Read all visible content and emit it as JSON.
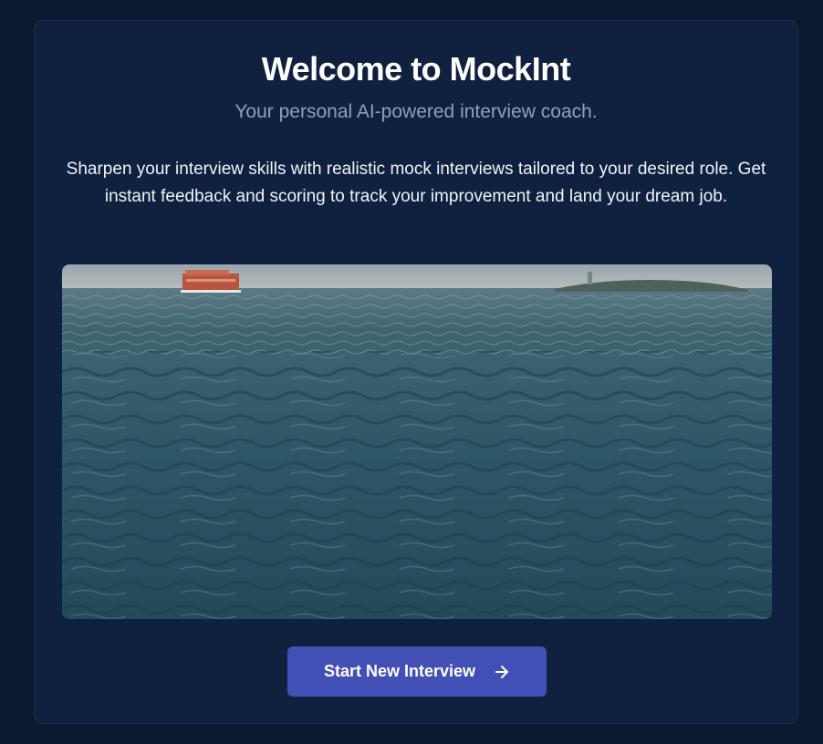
{
  "welcome": {
    "title": "Welcome to MockInt",
    "subtitle": "Your personal AI-powered interview coach.",
    "description": "Sharpen your interview skills with realistic mock interviews tailored to your desired role. Get instant feedback and scoring to track your improvement and land your dream job."
  },
  "hero_image": {
    "subject": "open water with a ferry and a distant island"
  },
  "actions": {
    "start_label": "Start New Interview",
    "start_icon": "arrow-right-icon"
  },
  "colors": {
    "page_background": "#0c1a30",
    "card_background": "#0f213f",
    "button": "#4250b5",
    "subtitle": "#8ea0b8"
  }
}
